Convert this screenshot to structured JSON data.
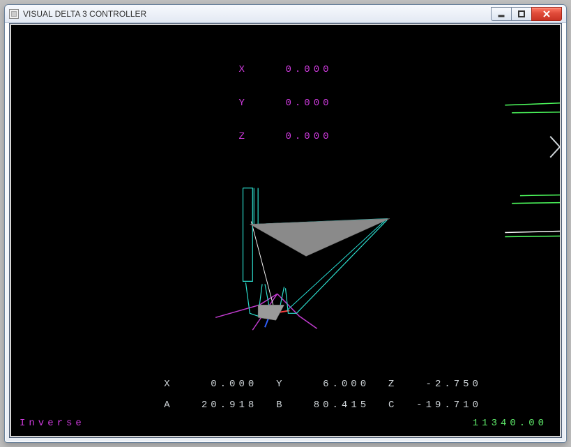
{
  "window": {
    "title": "VISUAL DELTA 3 CONTROLLER"
  },
  "top_readout": {
    "x_label": "X",
    "x_value": "0.000",
    "y_label": "Y",
    "y_value": "0.000",
    "z_label": "Z",
    "z_value": "0.000"
  },
  "bottom_row1": {
    "x_label": "X",
    "x_value": "0.000",
    "y_label": "Y",
    "y_value": "6.000",
    "z_label": "Z",
    "z_value": "-2.750"
  },
  "bottom_row2": {
    "a_label": "A",
    "a_value": "20.918",
    "b_label": "B",
    "b_value": "80.415",
    "c_label": "C",
    "c_value": "-19.710"
  },
  "mode": "Inverse",
  "counter": "11340.00"
}
